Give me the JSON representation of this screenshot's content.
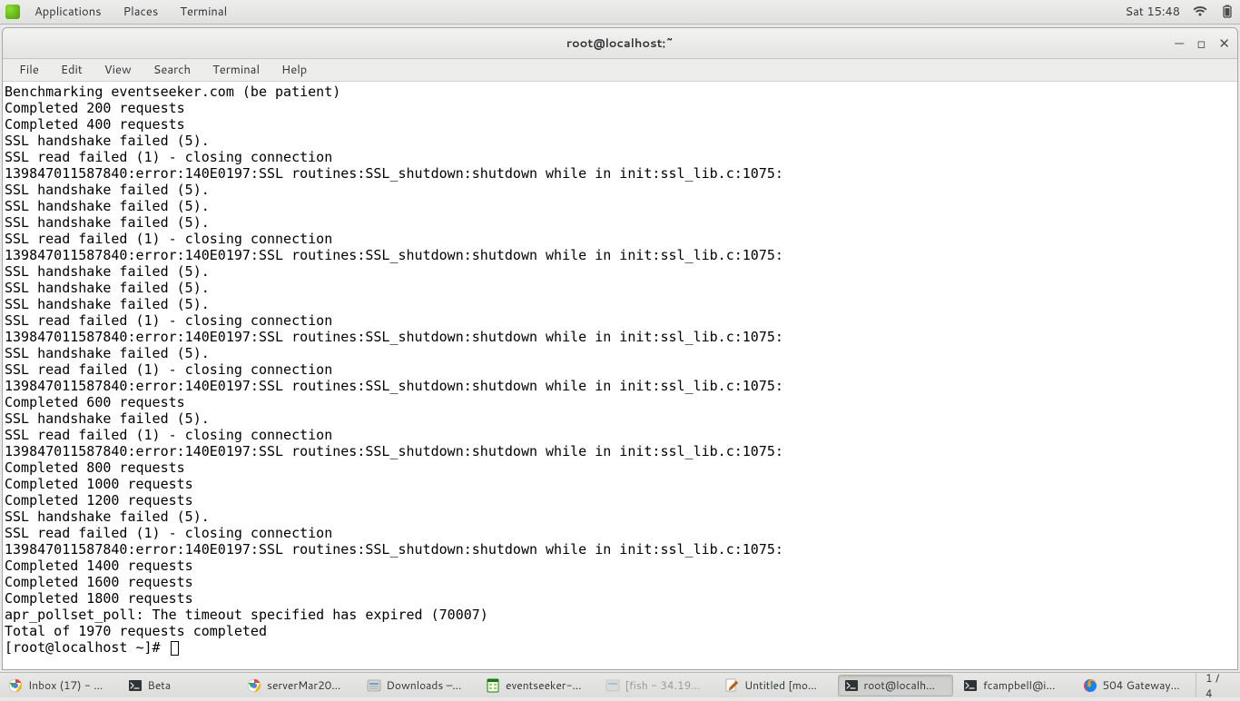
{
  "top_panel": {
    "apps": "Applications",
    "places": "Places",
    "active_app": "Terminal",
    "clock": "Sat 15:48"
  },
  "window": {
    "title": "root@localhost:~",
    "menus": [
      "File",
      "Edit",
      "View",
      "Search",
      "Terminal",
      "Help"
    ]
  },
  "terminal_lines": [
    "Benchmarking eventseeker.com (be patient)",
    "Completed 200 requests",
    "Completed 400 requests",
    "SSL handshake failed (5).",
    "SSL read failed (1) - closing connection",
    "139847011587840:error:140E0197:SSL routines:SSL_shutdown:shutdown while in init:ssl_lib.c:1075:",
    "SSL handshake failed (5).",
    "SSL handshake failed (5).",
    "SSL handshake failed (5).",
    "SSL read failed (1) - closing connection",
    "139847011587840:error:140E0197:SSL routines:SSL_shutdown:shutdown while in init:ssl_lib.c:1075:",
    "SSL handshake failed (5).",
    "SSL handshake failed (5).",
    "SSL handshake failed (5).",
    "SSL read failed (1) - closing connection",
    "139847011587840:error:140E0197:SSL routines:SSL_shutdown:shutdown while in init:ssl_lib.c:1075:",
    "SSL handshake failed (5).",
    "SSL read failed (1) - closing connection",
    "139847011587840:error:140E0197:SSL routines:SSL_shutdown:shutdown while in init:ssl_lib.c:1075:",
    "Completed 600 requests",
    "SSL handshake failed (5).",
    "SSL read failed (1) - closing connection",
    "139847011587840:error:140E0197:SSL routines:SSL_shutdown:shutdown while in init:ssl_lib.c:1075:",
    "Completed 800 requests",
    "Completed 1000 requests",
    "Completed 1200 requests",
    "SSL handshake failed (5).",
    "SSL read failed (1) - closing connection",
    "139847011587840:error:140E0197:SSL routines:SSL_shutdown:shutdown while in init:ssl_lib.c:1075:",
    "Completed 1400 requests",
    "Completed 1600 requests",
    "Completed 1800 requests",
    "apr_pollset_poll: The timeout specified has expired (70007)",
    "Total of 1970 requests completed"
  ],
  "prompt": "[root@localhost ~]# ",
  "taskbar": {
    "items": [
      {
        "label": "Inbox (17) - …",
        "icon": "chrome",
        "active": false
      },
      {
        "label": "Beta",
        "icon": "terminal",
        "active": false
      },
      {
        "label": "serverMar20…",
        "icon": "chrome",
        "active": false
      },
      {
        "label": "Downloads –…",
        "icon": "files",
        "active": false
      },
      {
        "label": "eventseeker-…",
        "icon": "calc",
        "active": false
      },
      {
        "label": "[fish - 34.19…",
        "icon": "files-dim",
        "active": false
      },
      {
        "label": "Untitled [mo…",
        "icon": "gedit",
        "active": false
      },
      {
        "label": "root@localh…",
        "icon": "terminal",
        "active": true
      },
      {
        "label": "fcampbell@i…",
        "icon": "terminal",
        "active": false
      },
      {
        "label": "504 Gateway…",
        "icon": "firefox",
        "active": false
      }
    ],
    "workspace": "1 / 4"
  }
}
